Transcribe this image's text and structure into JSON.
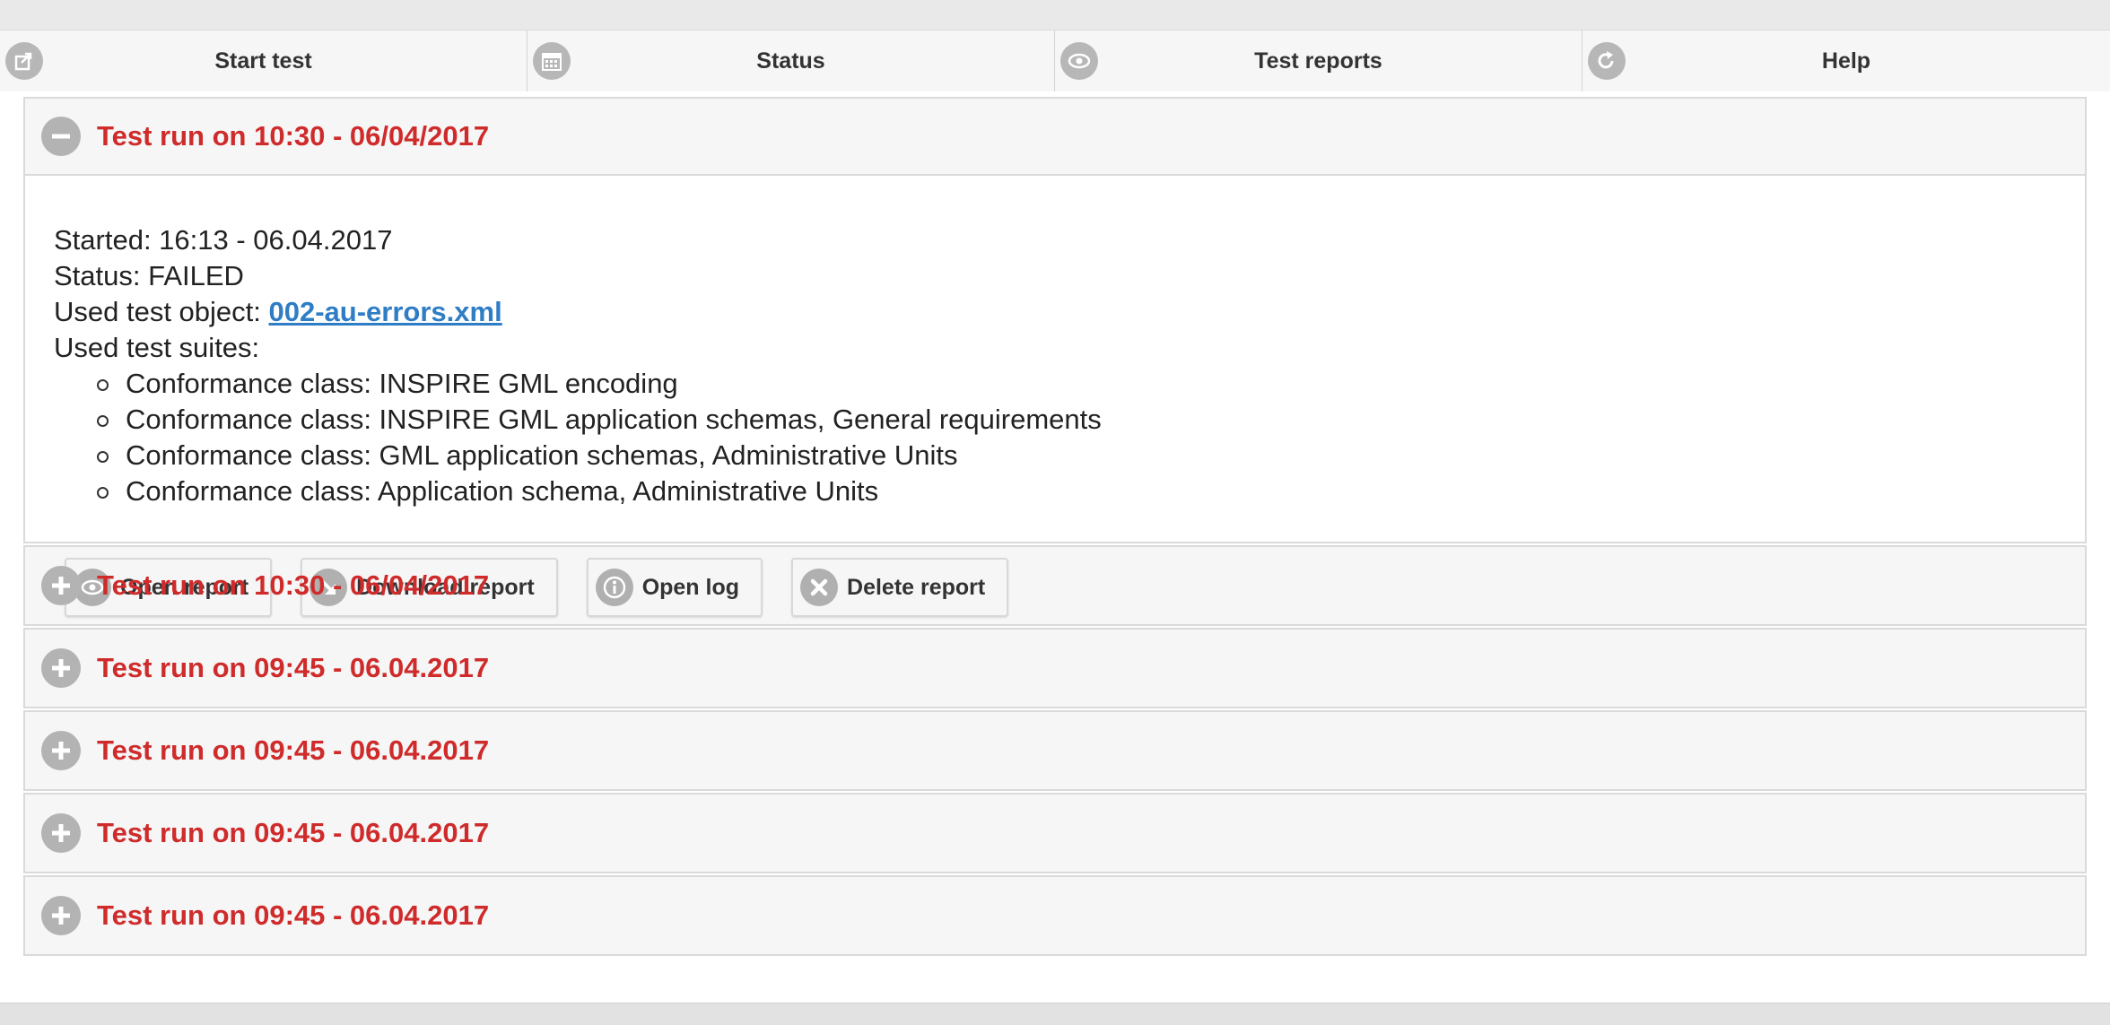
{
  "nav": {
    "tabs": [
      {
        "label": "Start test",
        "icon": "share-icon"
      },
      {
        "label": "Status",
        "icon": "calendar-icon"
      },
      {
        "label": "Test reports",
        "icon": "eye-icon"
      },
      {
        "label": "Help",
        "icon": "refresh-icon"
      }
    ]
  },
  "expanded_run": {
    "title": "Test run on 10:30 - 06/04/2017",
    "started_label": "Started: 16:13 - 06.04.2017",
    "status_label": "Status: FAILED",
    "test_object_label": "Used test object: ",
    "test_object_link": "002-au-errors.xml",
    "suites_label": "Used test suites:",
    "suites": [
      "Conformance class: INSPIRE GML encoding",
      "Conformance class: INSPIRE GML application schemas, General requirements",
      "Conformance class: GML application schemas, Administrative Units",
      "Conformance class: Application schema, Administrative Units"
    ],
    "buttons": {
      "open_report": "Open report",
      "download_report": "Download report",
      "open_log": "Open log",
      "delete_report": "Delete report"
    }
  },
  "collapsed_runs": [
    "Test run on 10:30 - 06/04/2017",
    "Test run on 09:45 - 06.04.2017",
    "Test run on 09:45 - 06.04.2017",
    "Test run on 09:45 - 06.04.2017",
    "Test run on 09:45 - 06.04.2017"
  ],
  "colors": {
    "title_red": "#cf2b2b",
    "link_blue": "#2e7dc5",
    "icon_gray": "#b3b3b3"
  }
}
